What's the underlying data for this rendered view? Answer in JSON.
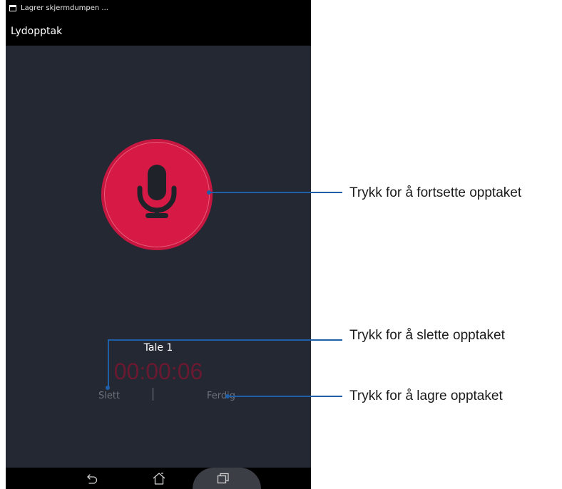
{
  "status_bar": {
    "notification_icon": "screenshot-icon",
    "text": "Lagrer skjermdumpen ..."
  },
  "app_bar": {
    "title": "Lydopptak"
  },
  "recorder": {
    "button_icon": "microphone-icon",
    "track_name": "Tale 1",
    "elapsed": "00:00:06",
    "delete_label": "Slett",
    "done_label": "Ferdig"
  },
  "navigation": {
    "back": "back-icon",
    "home": "home-icon",
    "recents": "recents-icon"
  },
  "annotations": {
    "record": "Trykk for å fortsette opptaket",
    "delete": "Trykk for å slette opptaket",
    "save": "Trykk for å lagre opptaket"
  },
  "colors": {
    "screen_bg": "#232833",
    "record_button": "#d61a45",
    "timer": "#6b1930",
    "callout": "#1f5fa8"
  }
}
